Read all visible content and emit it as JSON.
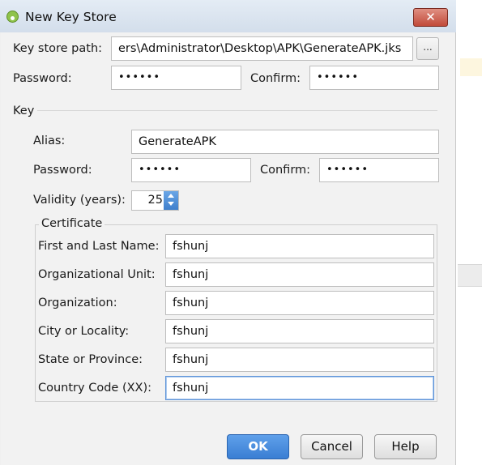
{
  "window": {
    "title": "New Key Store",
    "close_label": "✕"
  },
  "keystore": {
    "path_label": "Key store path:",
    "path_value": "ers\\Administrator\\Desktop\\APK\\GenerateAPK.jks",
    "browse_label": "...",
    "password_label": "Password:",
    "password_value": "••••••",
    "confirm_label": "Confirm:",
    "confirm_value": "••••••"
  },
  "key": {
    "section_label": "Key",
    "alias_label": "Alias:",
    "alias_value": "GenerateAPK",
    "password_label": "Password:",
    "password_value": "••••••",
    "confirm_label": "Confirm:",
    "confirm_value": "••••••",
    "validity_label": "Validity (years):",
    "validity_value": "25"
  },
  "certificate": {
    "section_label": "Certificate",
    "fields": [
      {
        "label": "First and Last Name:",
        "value": "fshunj"
      },
      {
        "label": "Organizational Unit:",
        "value": "fshunj"
      },
      {
        "label": "Organization:",
        "value": "fshunj"
      },
      {
        "label": "City or Locality:",
        "value": "fshunj"
      },
      {
        "label": "State or Province:",
        "value": "fshunj"
      },
      {
        "label": "Country Code (XX):",
        "value": "fshunj"
      }
    ]
  },
  "buttons": {
    "ok": "OK",
    "cancel": "Cancel",
    "help": "Help"
  }
}
